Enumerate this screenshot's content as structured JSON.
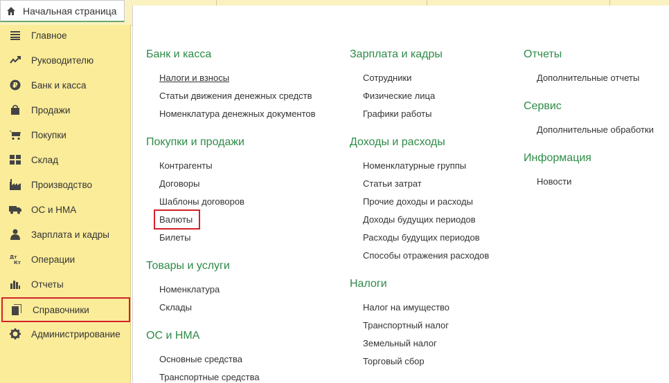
{
  "home_tab": {
    "label": "Начальная страница"
  },
  "sidebar": {
    "items": [
      {
        "label": "Главное",
        "icon": "menu-lines-icon"
      },
      {
        "label": "Руководителю",
        "icon": "trend-icon"
      },
      {
        "label": "Банк и касса",
        "icon": "ruble-icon"
      },
      {
        "label": "Продажи",
        "icon": "shopping-bag-icon"
      },
      {
        "label": "Покупки",
        "icon": "cart-icon"
      },
      {
        "label": "Склад",
        "icon": "grid-icon"
      },
      {
        "label": "Производство",
        "icon": "factory-icon"
      },
      {
        "label": "ОС и НМА",
        "icon": "truck-icon"
      },
      {
        "label": "Зарплата и кадры",
        "icon": "person-icon"
      },
      {
        "label": "Операции",
        "icon": "dt-kt-icon"
      },
      {
        "label": "Отчеты",
        "icon": "bar-chart-icon"
      },
      {
        "label": "Справочники",
        "icon": "books-icon",
        "active": true
      },
      {
        "label": "Администрирование",
        "icon": "gear-icon"
      }
    ]
  },
  "sections": {
    "bank": {
      "title": "Банк и касса",
      "links": [
        "Налоги и взносы",
        "Статьи движения денежных средств",
        "Номенклатура денежных документов"
      ]
    },
    "purchases_sales": {
      "title": "Покупки и продажи",
      "links": [
        "Контрагенты",
        "Договоры",
        "Шаблоны договоров",
        "Валюты",
        "Билеты"
      ]
    },
    "goods": {
      "title": "Товары и услуги",
      "links": [
        "Номенклатура",
        "Склады"
      ]
    },
    "os_nma": {
      "title": "ОС и НМА",
      "links": [
        "Основные средства",
        "Транспортные средства"
      ]
    },
    "salary": {
      "title": "Зарплата и кадры",
      "links": [
        "Сотрудники",
        "Физические лица",
        "Графики работы"
      ]
    },
    "income_expense": {
      "title": "Доходы и расходы",
      "links": [
        "Номенклатурные группы",
        "Статьи затрат",
        "Прочие доходы и расходы",
        "Доходы будущих периодов",
        "Расходы будущих периодов",
        "Способы отражения расходов"
      ]
    },
    "taxes": {
      "title": "Налоги",
      "links": [
        "Налог на имущество",
        "Транспортный налог",
        "Земельный налог",
        "Торговый сбор"
      ]
    },
    "reports": {
      "title": "Отчеты",
      "links": [
        "Дополнительные отчеты"
      ]
    },
    "service": {
      "title": "Сервис",
      "links": [
        "Дополнительные обработки"
      ]
    },
    "info": {
      "title": "Информация",
      "links": [
        "Новости"
      ]
    }
  },
  "colors": {
    "sidebar_bg": "#fbec9a",
    "group_title": "#2d8b47",
    "highlight": "#d3202a"
  }
}
